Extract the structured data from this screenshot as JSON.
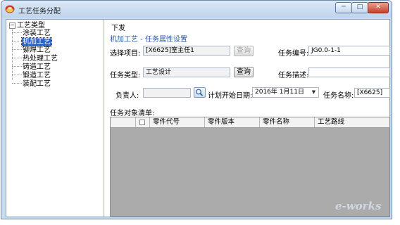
{
  "window": {
    "title": "工艺任务分配",
    "minimize": "─",
    "maximize": "□",
    "close": "✕"
  },
  "tree": {
    "root": "工艺类型",
    "expander": "−",
    "items": [
      "涂装工艺",
      "机加工艺",
      "铆焊工艺",
      "热处理工艺",
      "铸造工艺",
      "锻造工艺",
      "装配工艺"
    ],
    "selected_index": 1
  },
  "tab": "下发",
  "section_title": "机加工艺 - 任务属性设置",
  "form": {
    "select_item_label": "选择项目:",
    "select_item_value": "[X6625]室主任1",
    "query_button": "查询",
    "task_no_label": "任务编号:",
    "task_no_value": "JG0.0-1-1",
    "task_type_label": "任务类型:",
    "task_type_value": "工艺设计",
    "query_button_2": "查询",
    "task_desc_label": "任务描述:",
    "task_desc_value": "",
    "owner_label": "负责人:",
    "owner_value": "",
    "plan_start_label": "计划开始日期:",
    "plan_start_value": "2016年 1月11日",
    "task_name_label": "任务名称:",
    "task_name_value": "[X6625]"
  },
  "grid": {
    "title": "任务对象清单:",
    "columns": [
      "零件代号",
      "零件版本",
      "零件名称",
      "工艺路线"
    ]
  },
  "watermark": "e-works"
}
